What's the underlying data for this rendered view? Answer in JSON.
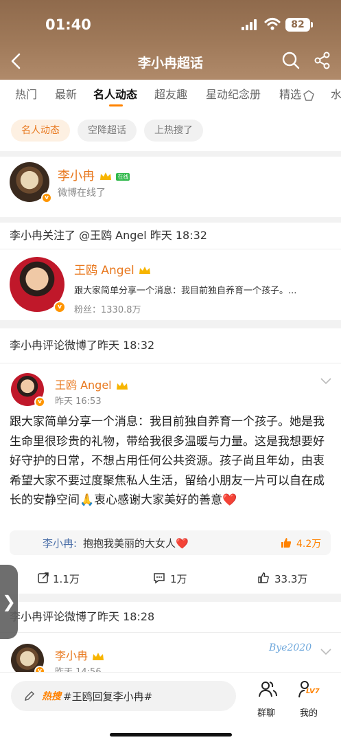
{
  "status_bar": {
    "time": "01:40",
    "battery": "82"
  },
  "nav": {
    "title": "李小冉超话"
  },
  "tabs": [
    {
      "label": "热门"
    },
    {
      "label": "最新"
    },
    {
      "label": "名人动态"
    },
    {
      "label": "超友趣"
    },
    {
      "label": "星动纪念册"
    },
    {
      "label": "精选"
    },
    {
      "label": "水"
    }
  ],
  "chips": [
    {
      "label": "名人动态"
    },
    {
      "label": "空降超话"
    },
    {
      "label": "上热搜了"
    }
  ],
  "profile": {
    "name": "李小冉",
    "online_badge": "在线",
    "status": "微博在线了"
  },
  "follow_event": {
    "header": "李小冉关注了 @王鸥 Angel 昨天 18:32",
    "name": "王鸥 Angel",
    "desc": "跟大家简单分享一个消息：我目前独自养育一个孩子。...",
    "fans": "粉丝：1330.8万"
  },
  "comment_event": {
    "header": "李小冉评论微博了昨天 18:32",
    "author": "王鸥 Angel",
    "time": "昨天 16:53",
    "text": "跟大家简单分享一个消息：我目前独自养育一个孩子。她是我生命里很珍贵的礼物，带给我很多温暖与力量。这是我想要好好守护的日常，不想占用任何公共资源。孩子尚且年幼，由衷希望大家不要过度聚焦私人生活，留给小朋友一片可以自在成长的安静空间🙏衷心感谢大家美好的善意❤️",
    "comment_author": "李小冉:",
    "comment_text": "抱抱我美丽的大女人❤️",
    "comment_likes": "4.2万",
    "reposts": "1.1万",
    "comments": "1万",
    "likes": "33.3万"
  },
  "comment_event_2": {
    "header": "李小冉评论微博了昨天 18:28",
    "author": "李小冉",
    "time": "昨天 14:56",
    "decor_text": "Bye2020"
  },
  "bottom": {
    "hot_tag": "热搜",
    "input_text": "#王鸥回复李小冉#",
    "group_label": "群聊",
    "level_badge": "LV7",
    "me_label": "我的"
  },
  "colors": {
    "accent": "#ff8200",
    "name_orange": "#e8781e",
    "header_brown": "#9a7455"
  }
}
